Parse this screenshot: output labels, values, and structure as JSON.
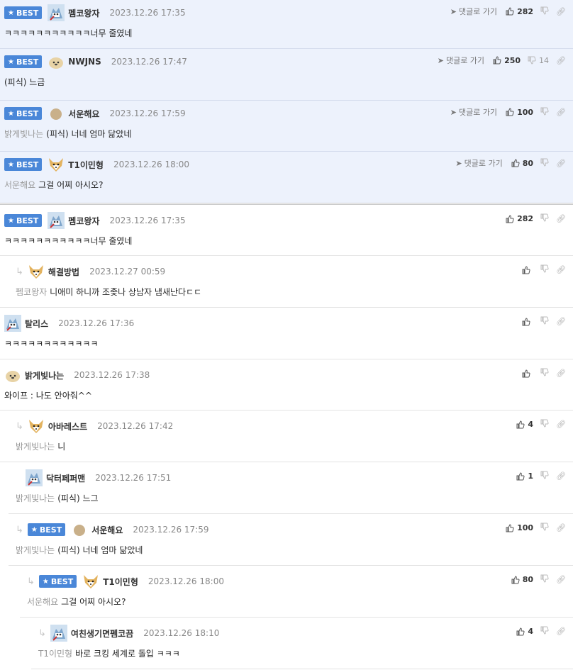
{
  "best_label": "BEST",
  "goto_label": "댓글로 가기",
  "best_comments": [
    {
      "user": "펨코왕자",
      "date": "2023.12.26 17:35",
      "mention": "",
      "text": "ㅋㅋㅋㅋㅋㅋㅋㅋㅋㅋㅋ너무 줄였네",
      "likes": "282",
      "dislikes": ""
    },
    {
      "user": "NWJNS",
      "date": "2023.12.26 17:47",
      "mention": "",
      "text": "(피식) 느금",
      "likes": "250",
      "dislikes": "14"
    },
    {
      "user": "서운해요",
      "date": "2023.12.26 17:59",
      "mention": "밝게빛나는",
      "text": "(피식) 너네 엄마 닮았네",
      "likes": "100",
      "dislikes": ""
    },
    {
      "user": "T1이민형",
      "date": "2023.12.26 18:00",
      "mention": "서운해요",
      "text": "그걸 어찌 아시오?",
      "likes": "80",
      "dislikes": ""
    }
  ],
  "comments": [
    {
      "user": "펨코왕자",
      "date": "2023.12.26 17:35",
      "mention": "",
      "text": "ㅋㅋㅋㅋㅋㅋㅋㅋㅋㅋㅋ너무 줄였네",
      "likes": "282",
      "best": true
    },
    {
      "user": "해결방법",
      "date": "2023.12.27 00:59",
      "mention": "펨코왕자",
      "text": "니애미 하니까 조좆나 상남자 냄새난다ㄷㄷ",
      "likes": "",
      "best": false
    },
    {
      "user": "탈리스",
      "date": "2023.12.26 17:36",
      "mention": "",
      "text": "ㅋㅋㅋㅋㅋㅋㅋㅋㅋㅋㅋㅋ",
      "likes": "",
      "best": false
    },
    {
      "user": "밝게빛나는",
      "date": "2023.12.26 17:38",
      "mention": "",
      "text": "와이프 : 나도 안아줘^^",
      "likes": "",
      "best": false
    },
    {
      "user": "아바레스트",
      "date": "2023.12.26 17:42",
      "mention": "밝게빛나는",
      "text": "니",
      "likes": "4",
      "best": false
    },
    {
      "user": "닥터페퍼맨",
      "date": "2023.12.26 17:51",
      "mention": "밝게빛나는",
      "text": "(피식) 느그",
      "likes": "1",
      "best": false
    },
    {
      "user": "서운해요",
      "date": "2023.12.26 17:59",
      "mention": "밝게빛나는",
      "text": "(피식) 너네 엄마 닮았네",
      "likes": "100",
      "best": true
    },
    {
      "user": "T1이민형",
      "date": "2023.12.26 18:00",
      "mention": "서운해요",
      "text": "그걸 어찌 아시오?",
      "likes": "80",
      "best": true
    },
    {
      "user": "여친생기면펨코끔",
      "date": "2023.12.26 18:10",
      "mention": "T1이민형",
      "text": "바로 크킹 세계로 돌입 ㅋㅋㅋ",
      "likes": "4",
      "best": false
    }
  ]
}
